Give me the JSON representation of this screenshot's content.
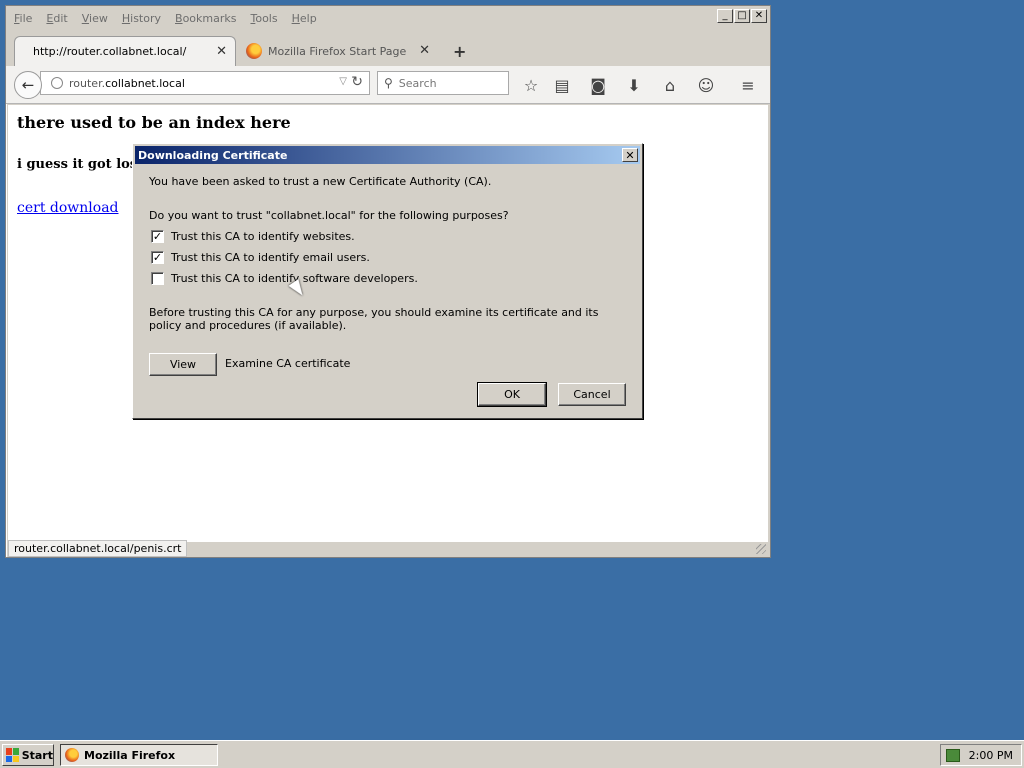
{
  "menubar": {
    "items": [
      "File",
      "Edit",
      "View",
      "History",
      "Bookmarks",
      "Tools",
      "Help"
    ]
  },
  "window_controls": {
    "minimize": "_",
    "maximize": "□",
    "close": "✕"
  },
  "tabs": [
    {
      "label": "http://router.collabnet.local/",
      "active": true
    },
    {
      "label": "Mozilla Firefox Start Page",
      "active": false
    }
  ],
  "navbar": {
    "url_host": "router.",
    "url_domain": "collabnet.local",
    "search_placeholder": "Search"
  },
  "page": {
    "heading": "there used to be an index here",
    "subheading": "i guess it got lost",
    "link": "cert download"
  },
  "statusbar": {
    "text": "router.collabnet.local/penis.crt"
  },
  "dialog": {
    "title": "Downloading Certificate",
    "intro": "You have been asked to trust a new Certificate Authority (CA).",
    "question": "Do you want to trust \"collabnet.local\" for the following purposes?",
    "options": [
      {
        "label": "Trust this CA to identify websites.",
        "checked": true
      },
      {
        "label": "Trust this CA to identify email users.",
        "checked": true
      },
      {
        "label": "Trust this CA to identify software developers.",
        "checked": false
      }
    ],
    "warning": "Before trusting this CA for any purpose, you should examine its certificate and its policy and procedures (if available).",
    "view_button": "View",
    "view_label": "Examine CA certificate",
    "ok_button": "OK",
    "cancel_button": "Cancel"
  },
  "taskbar": {
    "start_label": "Start",
    "task_label": "Mozilla Firefox",
    "clock": "2:00 PM"
  },
  "colors": {
    "desktop": "#3a6ea5",
    "titlebar_start": "#0a246a",
    "titlebar_end": "#a6caf0",
    "link": "#0000ee"
  }
}
